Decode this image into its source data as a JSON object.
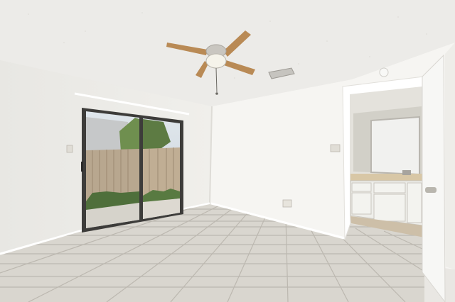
{
  "scene": {
    "colors": {
      "ceiling": "#ecebe8",
      "wall_left": "#efeeea",
      "wall_back": "#f6f5f2",
      "wall_right": "#f2f1ee",
      "floor_tile": "#d9d6cf",
      "grout": "#b9b5ad",
      "door": "#f7f7f5",
      "cabinet": "#eeeeea",
      "countertop": "#d8c7a6",
      "fan_blade": "#b98a55",
      "fan_metal": "#c9c6c0",
      "fence": "#b8a78f",
      "foliage": "#6f8f4f",
      "door_frame": "#3d3c3a"
    },
    "objects": [
      "textured-ceiling",
      "ceiling-fan",
      "ac-vent",
      "smoke-detector",
      "sliding-glass-door",
      "wooden-fence",
      "light-switch",
      "wall-outlet",
      "tile-floor",
      "bathroom-doorway",
      "bathroom-vanity",
      "bathroom-mirror",
      "interior-door"
    ]
  }
}
